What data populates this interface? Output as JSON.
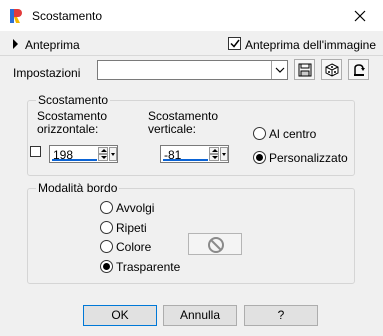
{
  "window": {
    "title": "Scostamento",
    "close_icon": "close-x-icon"
  },
  "preview": {
    "toggle_label": "Anteprima",
    "image_preview_label": "Anteprima dell'immagine",
    "image_preview_checked": true
  },
  "settings": {
    "label": "Impostazioni",
    "value": "",
    "icons": [
      "save-icon",
      "dice-icon",
      "reset-icon"
    ]
  },
  "offset_group": {
    "title": "Scostamento",
    "horizontal_label_line1": "Scostamento",
    "horizontal_label_line2": "orizzontale:",
    "horizontal_value": "198",
    "vertical_label_line1": "Scostamento",
    "vertical_label_line2": "verticale:",
    "vertical_value": "-81",
    "link_checked": false,
    "centered_label": "Al centro",
    "custom_label": "Personalizzato",
    "selected": "Personalizzato"
  },
  "edge_group": {
    "title": "Modalità bordo",
    "options": [
      "Avvolgi",
      "Ripeti",
      "Colore",
      "Trasparente"
    ],
    "selected": "Trasparente"
  },
  "buttons": {
    "ok": "OK",
    "cancel": "Annulla",
    "help": "?"
  }
}
